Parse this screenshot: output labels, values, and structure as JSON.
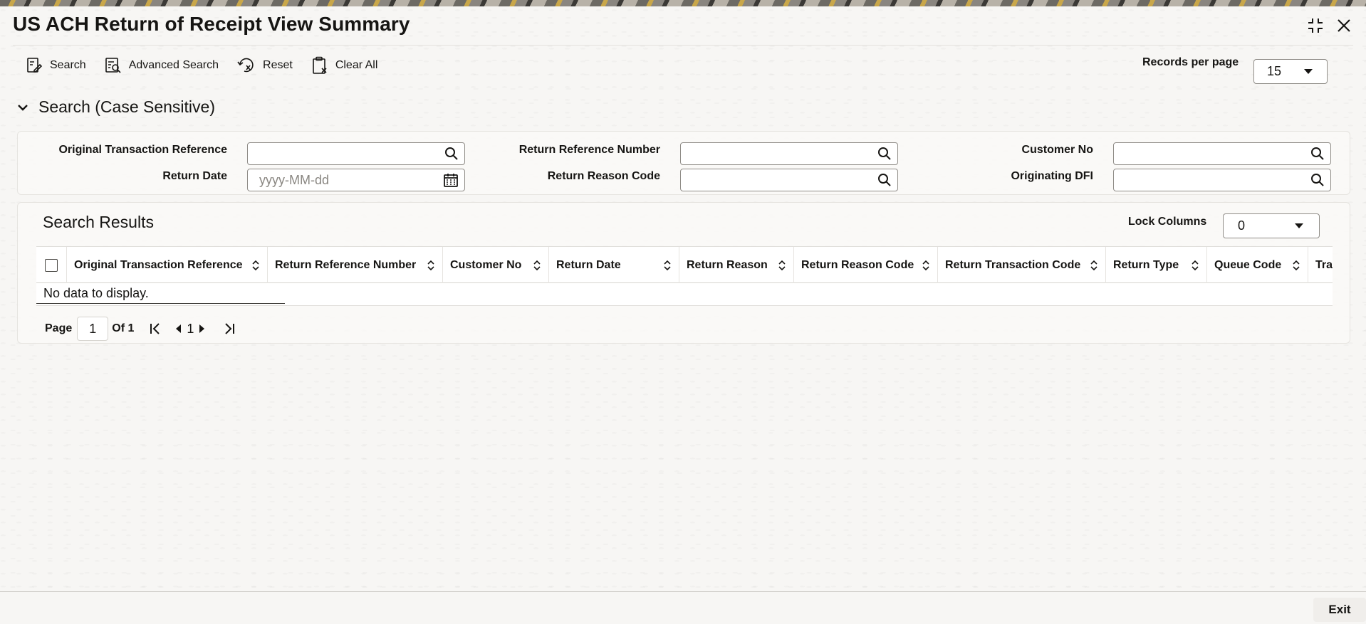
{
  "window": {
    "title": "US ACH Return of Receipt View Summary",
    "controls": [
      {
        "name": "collapse-icon"
      },
      {
        "name": "close-icon"
      }
    ]
  },
  "toolbar": {
    "search_label": "Search",
    "advanced_search_label": "Advanced Search",
    "reset_label": "Reset",
    "clear_all_label": "Clear All",
    "records_per_page_label": "Records per page",
    "records_per_page_value": "15"
  },
  "search": {
    "section_title": "Search (Case Sensitive)",
    "fields": {
      "original_transaction_reference": {
        "label": "Original Transaction Reference",
        "value": "",
        "icon": "search-icon"
      },
      "return_reference_number": {
        "label": "Return Reference Number",
        "value": "",
        "icon": "search-icon"
      },
      "customer_no": {
        "label": "Customer No",
        "value": "",
        "icon": "search-icon"
      },
      "return_date": {
        "label": "Return Date",
        "value": "",
        "placeholder": "yyyy-MM-dd",
        "icon": "calendar-icon"
      },
      "return_reason_code": {
        "label": "Return Reason Code",
        "value": "",
        "icon": "search-icon"
      },
      "originating_dfi": {
        "label": "Originating DFI",
        "value": "",
        "icon": "search-icon"
      }
    }
  },
  "results": {
    "title": "Search Results",
    "lock_columns_label": "Lock Columns",
    "lock_columns_value": "0",
    "columns": [
      "Original Transaction Reference",
      "Return Reference Number",
      "Customer No",
      "Return Date",
      "Return Reason",
      "Return Reason Code",
      "Return Transaction Code",
      "Return Type",
      "Queue Code",
      "Tra"
    ],
    "rows": [],
    "empty_message": "No data to display."
  },
  "pagination": {
    "page_label": "Page",
    "page_value": "1",
    "of_label": "Of 1",
    "current_page": "1"
  },
  "footer": {
    "exit_label": "Exit"
  }
}
